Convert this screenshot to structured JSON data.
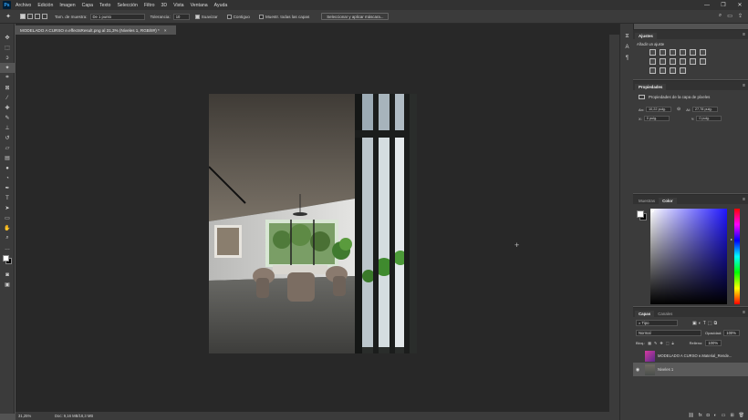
{
  "app": {
    "logo": "Ps",
    "menu": [
      "Archivo",
      "Edición",
      "Imagen",
      "Capa",
      "Texto",
      "Selección",
      "Filtro",
      "3D",
      "Vista",
      "Ventana",
      "Ayuda"
    ],
    "window_controls": [
      "—",
      "❐",
      "✕"
    ]
  },
  "options": {
    "sample_size_label": "Tam. de muestra:",
    "sample_size_value": "De 1 punto",
    "tolerance_label": "Tolerancia:",
    "tolerance_value": "10",
    "smooth_label": "Suavizar",
    "contiguous_label": "Contiguo",
    "all_layers_label": "Muestr. todas las capas",
    "select_mask_button": "Seleccionar y aplicar máscara..."
  },
  "document": {
    "tab_title": "MODELADO A CURSO e.effectsResult.png al 31,3% (Niveles 1, RGB/8#) *",
    "tab_close": "×"
  },
  "status": {
    "zoom": "31,25%",
    "doc_info": "Doc: 9,16 MB/18,3 MB"
  },
  "panels": {
    "adjustments": {
      "tabs": [
        "Ajustes"
      ],
      "add_label": "Añadir un ajuste"
    },
    "properties": {
      "tabs": [
        "Propiedades"
      ],
      "subtitle": "Propiedades de la capa de píxeles",
      "w_label": "An:",
      "w_value": "10,22 pulg.",
      "h_label": "Al:",
      "h_value": "27,78 pulg.",
      "x_label": "X:",
      "x_value": "0 pulg.",
      "y_label": "Y:",
      "y_value": "0 pulg."
    },
    "color": {
      "tabs": [
        "Muestras",
        "Color"
      ],
      "active_tab": "Color"
    },
    "layers": {
      "tabs": [
        "Capas",
        "Canales"
      ],
      "filter_label": "Tipo",
      "blend_mode": "Normal",
      "opacity_label": "Opacidad:",
      "opacity_value": "100%",
      "lock_label": "Bloq.:",
      "fill_label": "Relleno:",
      "fill_value": "100%",
      "items": [
        {
          "name": "MODELADO A CURSO e.Material_Rende..."
        },
        {
          "name": "Niveles 1"
        }
      ]
    }
  },
  "colors": {
    "accent": "#31a8ff",
    "selected_layer": "#5a5a5a"
  }
}
